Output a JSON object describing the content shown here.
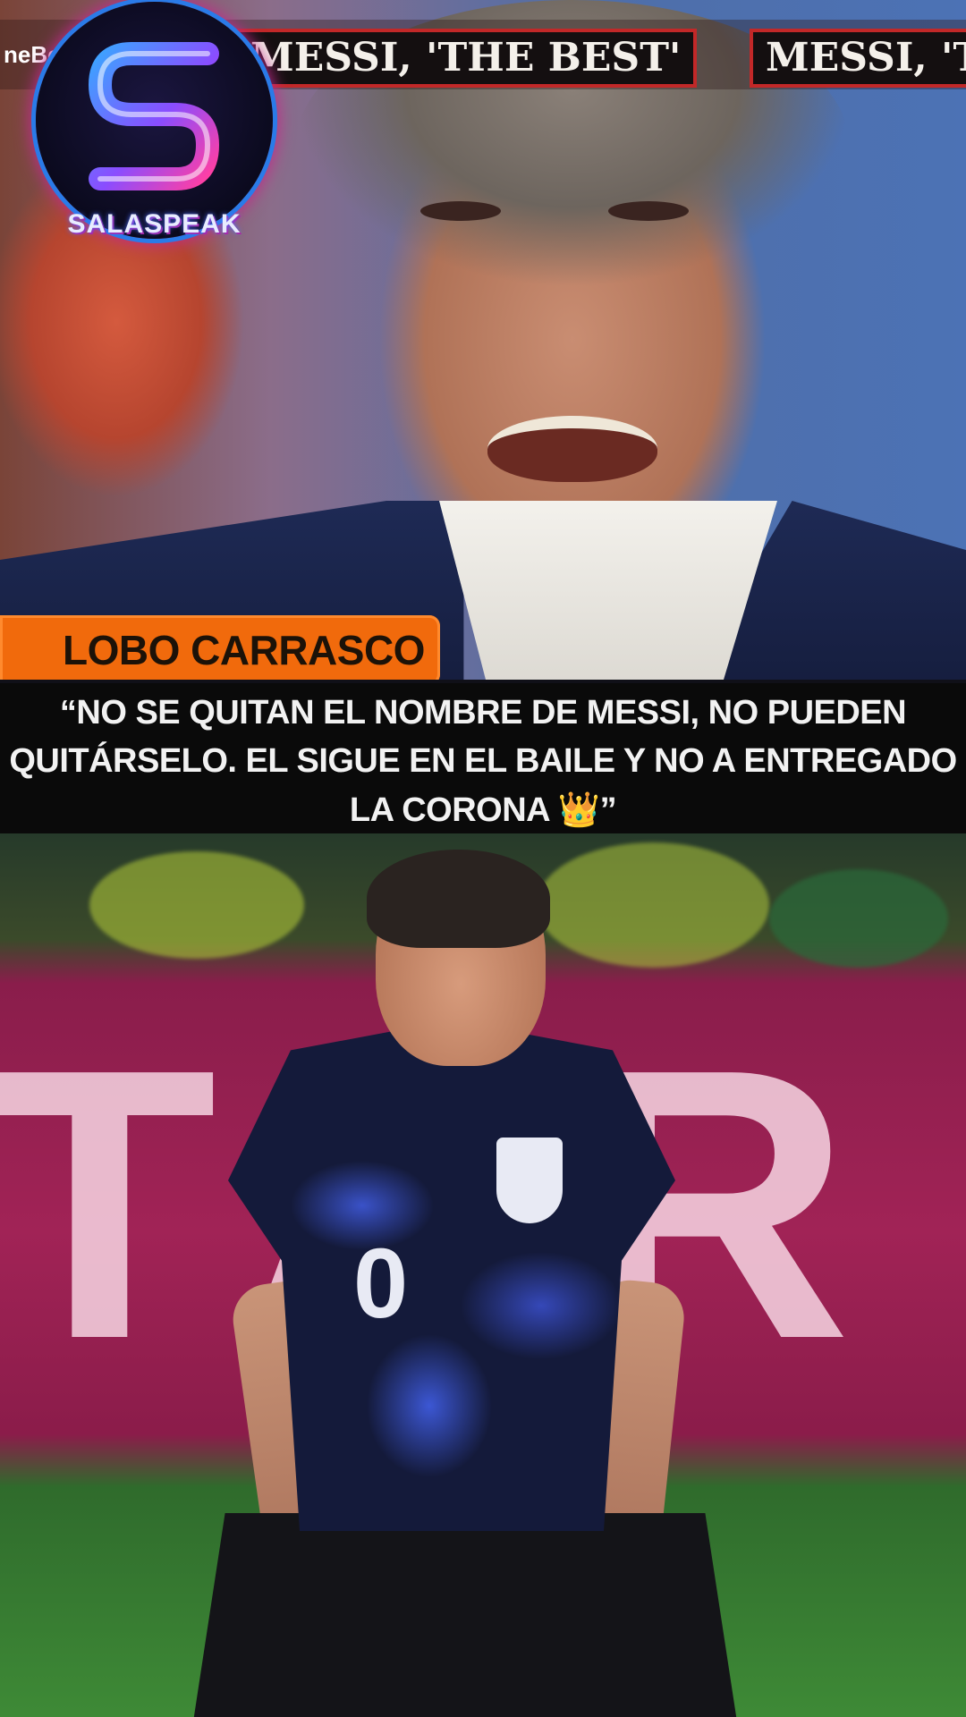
{
  "ticker": {
    "left_fragment": "neBe",
    "item_1": "MESSI, 'THE BEST'",
    "item_2": "MESSI, 'T",
    "colors": {
      "border": "#c22828",
      "background": "#140f10"
    }
  },
  "logo": {
    "name": "SALASPEAK",
    "icon": "s-letter-icon",
    "colors": {
      "ring": "#2a7be8",
      "glow": "#c22b8c"
    }
  },
  "name_tag": {
    "label": "LOBO CARRASCO",
    "color": "#f16a0c"
  },
  "quote": {
    "line_1": "“NO SE QUITAN EL NOMBRE DE MESSI, NO PUEDEN",
    "line_2": "QUITÁRSELO. EL SIGUE EN EL BAILE Y NO A ENTREGADO",
    "line_3": "LA CORONA",
    "emoji": "👑",
    "closing": "”"
  },
  "bottom_photo": {
    "background_text": "TAR",
    "jersey_number": "0"
  }
}
